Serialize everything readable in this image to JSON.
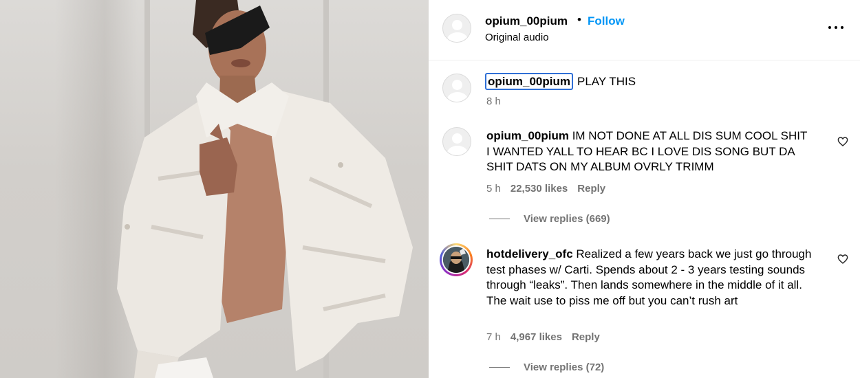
{
  "post": {
    "username": "opium_00pium",
    "separator": "•",
    "follow_label": "Follow",
    "audio_label": "Original audio",
    "more_icon": "more-horizontal-icon"
  },
  "caption": {
    "username": "opium_00pium",
    "text": "PLAY THIS",
    "time": "8 h"
  },
  "comments": [
    {
      "username": "opium_00pium",
      "text": "IM NOT DONE AT ALL DIS SUM COOL SHIT I WANTED YALL TO HEAR BC I LOVE DIS SONG BUT DA SHIT DATS ON MY ALBUM OVRLY TRIMM",
      "time": "5 h",
      "likes": "22,530 likes",
      "reply_label": "Reply",
      "view_replies": "View replies (669)"
    },
    {
      "username": "hotdelivery_ofc",
      "text": "Realized a few years back we just go through test phases w/ Carti. Spends about 2 - 3 years testing sounds through “leaks”. Then lands somewhere in the middle of it all. The wait use to piss me off but you can’t rush art",
      "time": "7 h",
      "likes": "4,967 likes",
      "reply_label": "Reply",
      "view_replies": "View replies (72)"
    }
  ],
  "colors": {
    "follow": "#0095f6",
    "muted": "#737373",
    "focus_outline": "#2f6fd6"
  }
}
